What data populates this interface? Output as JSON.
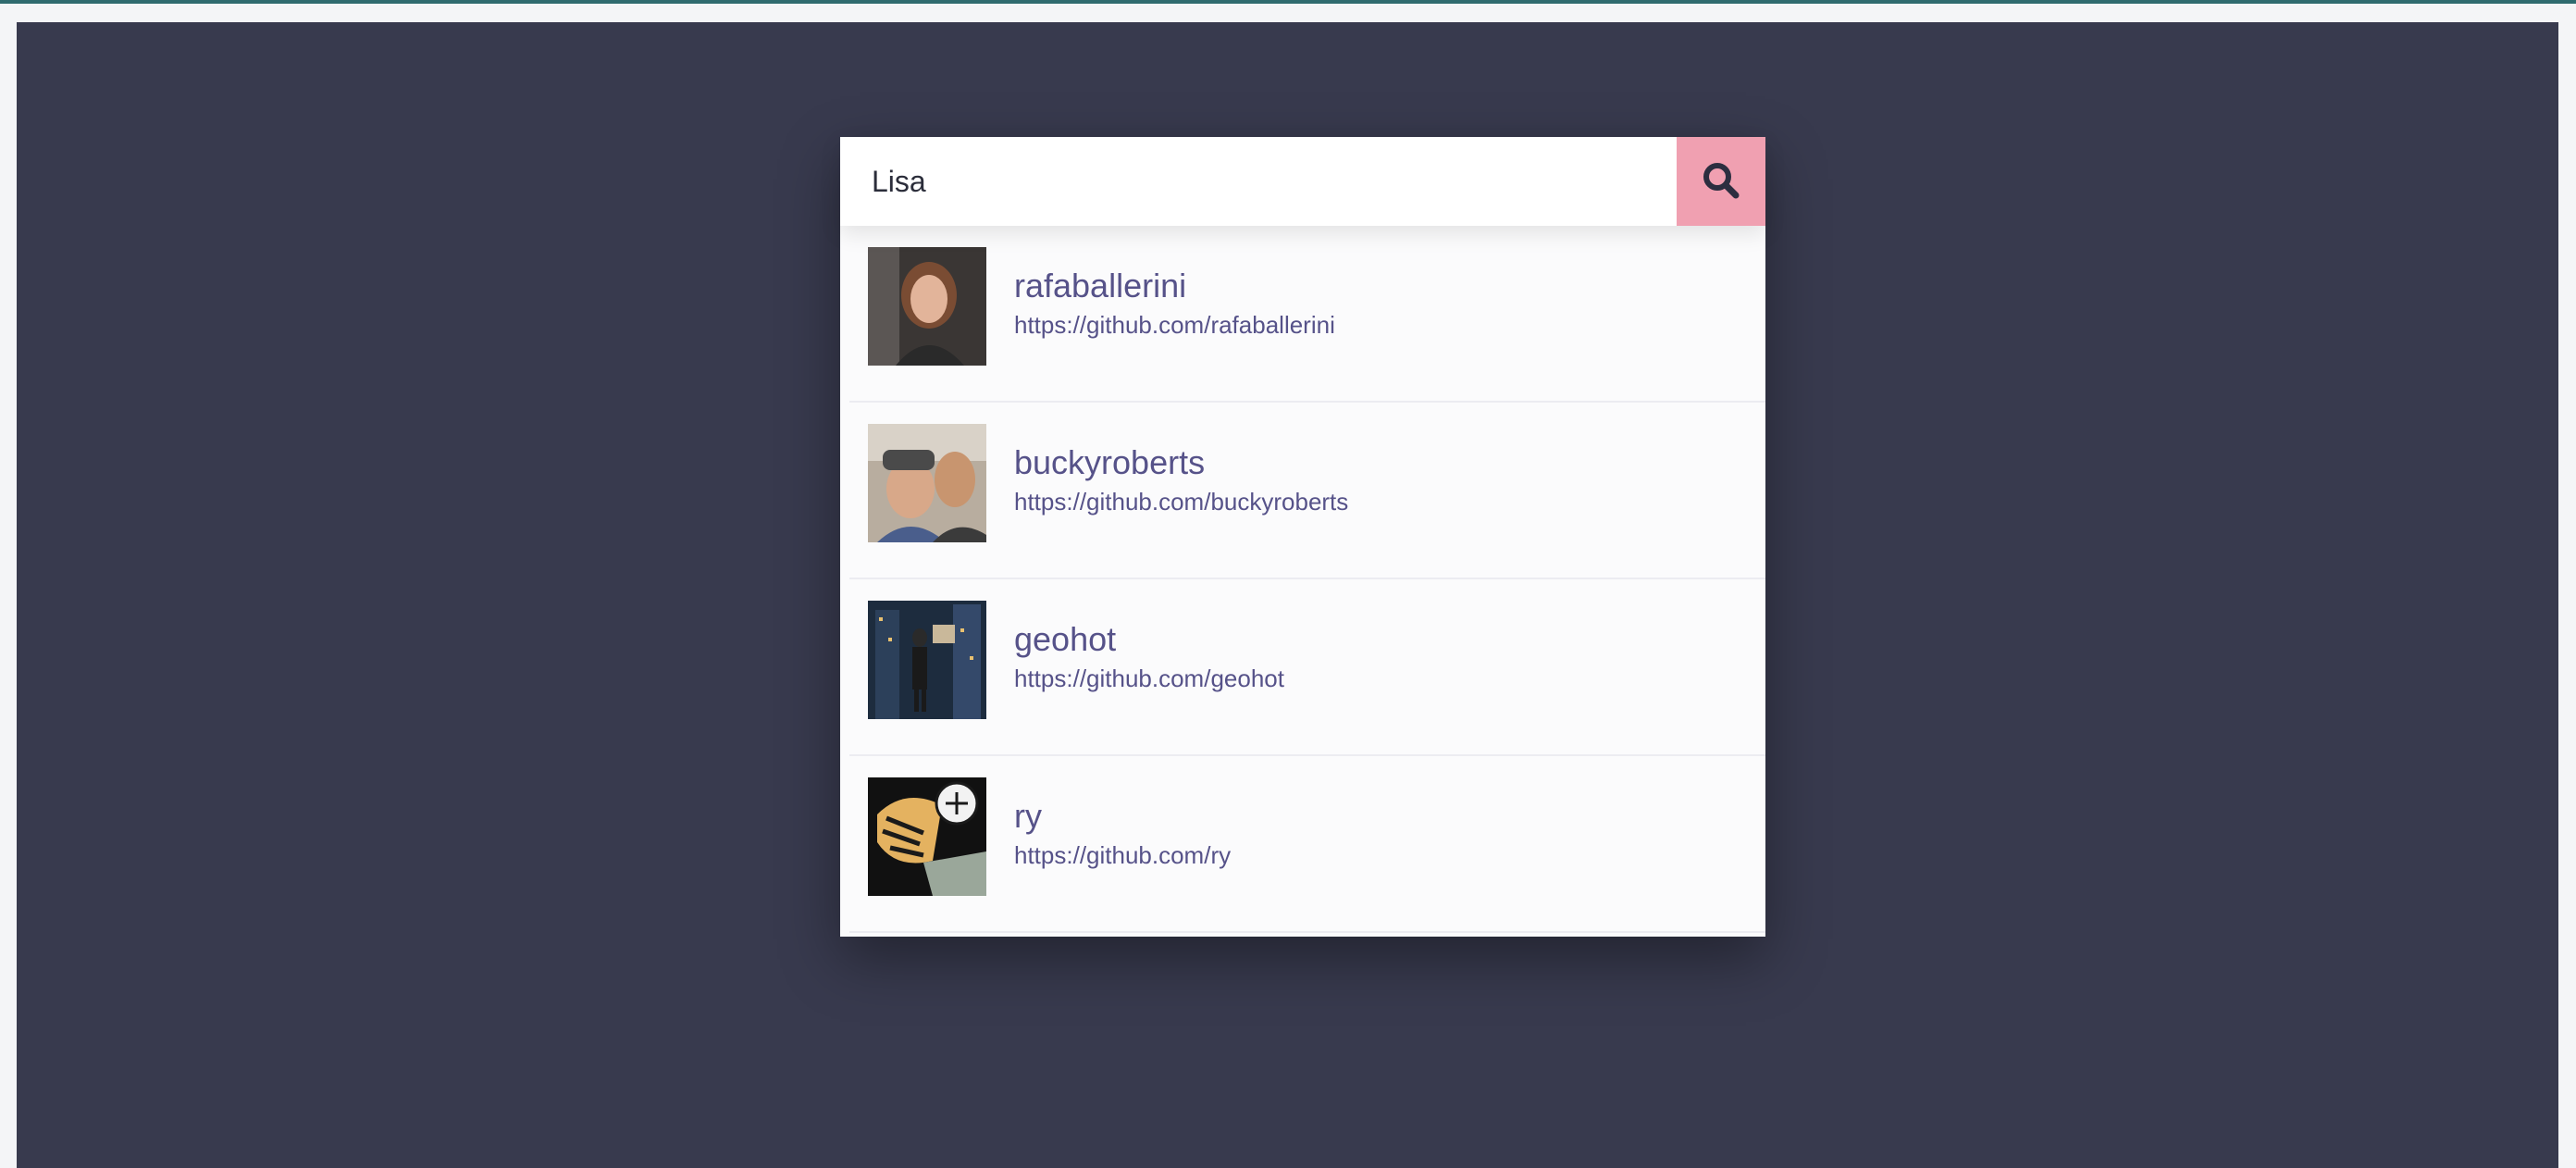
{
  "search": {
    "value": "Lisa",
    "button_icon": "search-icon"
  },
  "colors": {
    "page_background": "#383a4e",
    "accent": "#f0a0b1",
    "link_text": "#565289"
  },
  "results": [
    {
      "username": "rafaballerini",
      "url": "https://github.com/rafaballerini"
    },
    {
      "username": "buckyroberts",
      "url": "https://github.com/buckyroberts"
    },
    {
      "username": "geohot",
      "url": "https://github.com/geohot"
    },
    {
      "username": "ry",
      "url": "https://github.com/ry"
    }
  ]
}
